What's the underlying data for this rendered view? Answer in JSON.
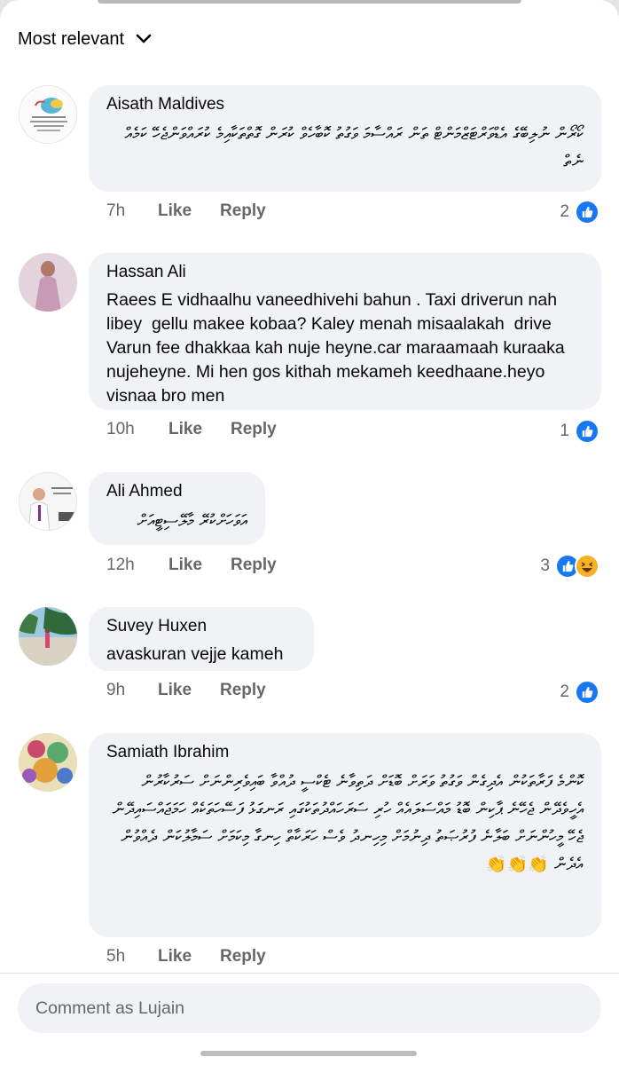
{
  "sort": {
    "label": "Most relevant"
  },
  "comments": [
    {
      "author": "Aisath Maldives",
      "text": "ކޯރޯން ނުލިބޭގެ އެޑްވަރްޓަޒްމަންޓް ތަން ރައްސާމަ ވަގުތު ކޮބާހެވް ކުރަން ގޮތްތަކާއިމެ ކުރައްވަންޖެހޭ ކަމެއް ނެތް",
      "time": "7h",
      "like": "Like",
      "reply": "Reply",
      "reactions": "2"
    },
    {
      "author": "Hassan Ali",
      "text": "Raees E vidhaalhu vaneedhivehi bahun . Taxi driverun nah libey  gellu makee kobaa? Kaley menah misaalakah  drive Varun fee dhakkaa kah nuje heyne.car maraamaah kuraaka nujeheyne. Mi hen gos kithah mekameh keedhaane.heyo visnaa bro men",
      "time": "10h",
      "like": "Like",
      "reply": "Reply",
      "reactions": "1"
    },
    {
      "author": "Ali Ahmed",
      "text": "އަވަހަށްކުރޭ މާލޭސިޓީއަށް",
      "time": "12h",
      "like": "Like",
      "reply": "Reply",
      "reactions": "3"
    },
    {
      "author": "Suvey Huxen",
      "text": "avaskuran vejje kameh",
      "time": "9h",
      "like": "Like",
      "reply": "Reply",
      "reactions": "2"
    },
    {
      "author": "Samiath Ibrahim",
      "text": "ކޮންމެ ފަރާތަކުން އެދިގެން ވަގުތު ވަރަށް ބޮޑަށް ދަތިވާނެ ޓެކްސީ ދުއްވާ ބައިވެރިންނަށް ސަރުކާރުން އެހީވެދޭން ޖެހޭނެ ޕާކިން ބޮޑު މައްސަލައެއް ހުރި ސަރަހައްދުތަކުގައި ރަނގަޅު ފަސޭހަތަކެއް ހަމަޖައްސައިދޭން ޖެހޭ މީހުންނަށް ބަލާނެ ފުރުޞަތު ދިނުމަށް މިހިނދު ވެސް ހަރަކާތް ހިނގާ މިކަމަށް ސަމާލުކަން ދެއްވުން އެދެން 👏👏👏",
      "time": "5h",
      "like": "Like",
      "reply": "Reply",
      "reactions": ""
    }
  ],
  "compose": {
    "placeholder": "Comment as Lujain"
  },
  "colors": {
    "accent": "#1877f2",
    "bubble": "#f0f2f5",
    "meta": "#65676b"
  }
}
